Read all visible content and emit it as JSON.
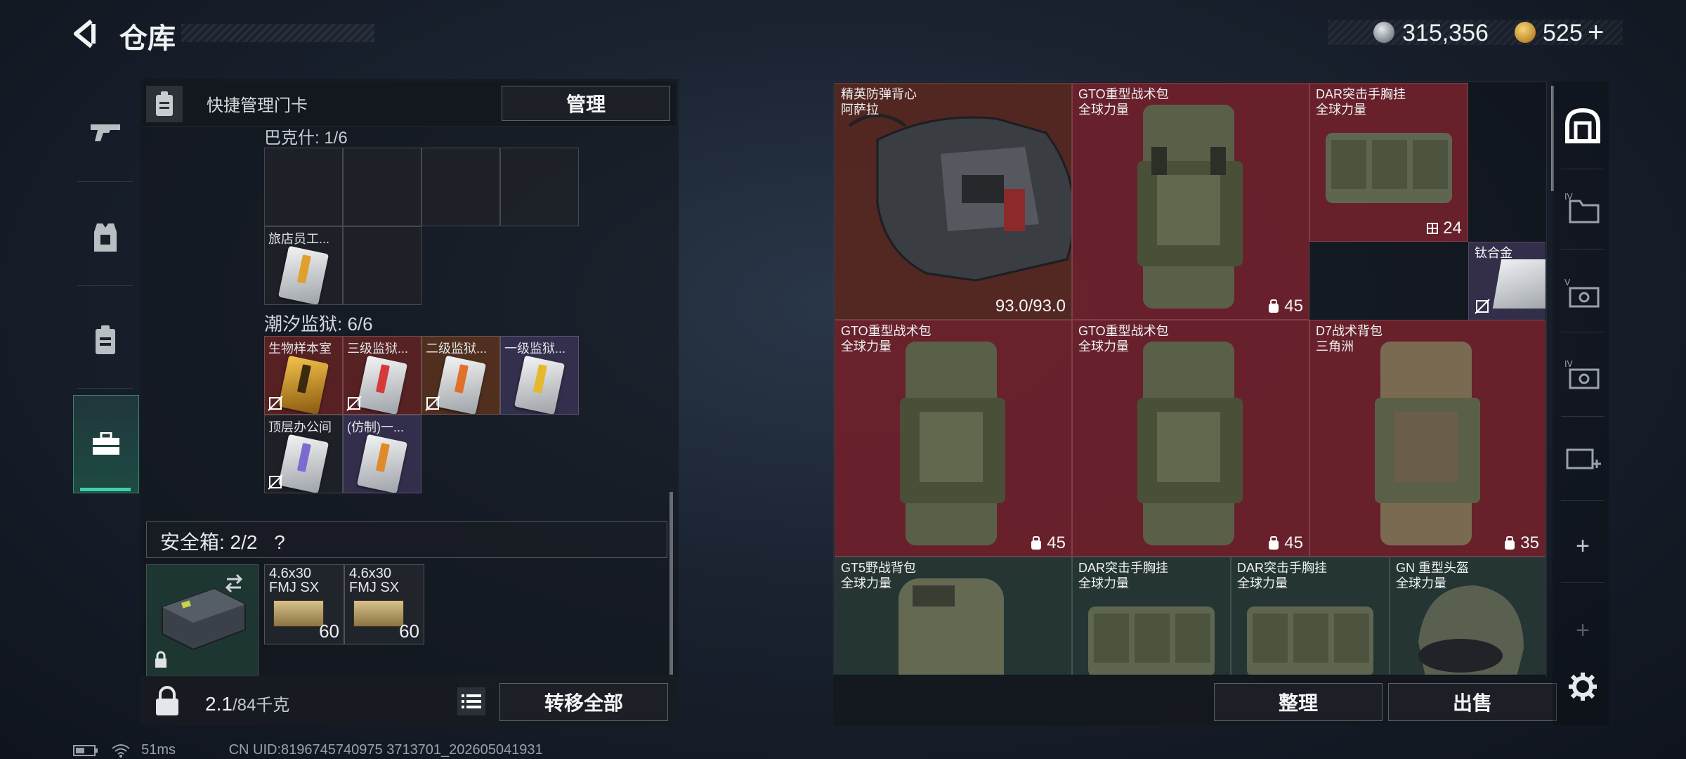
{
  "header": {
    "title": "仓库"
  },
  "currency": {
    "coins": "315,356",
    "premium": "525",
    "plus": "+"
  },
  "side_tabs": [
    "weapons",
    "armor",
    "keycard",
    "briefcase"
  ],
  "panel": {
    "header_label": "快捷管理门卡",
    "manage_btn": "管理",
    "clipped_section": "巴克什: 1/6",
    "section1_slots": [
      {
        "label": "旅店员工..."
      }
    ],
    "section2_title": "潮汐监狱: 6/6",
    "section2_slots": [
      {
        "label": "生物样本室"
      },
      {
        "label": "三级监狱..."
      },
      {
        "label": "二级监狱..."
      },
      {
        "label": "一级监狱..."
      },
      {
        "label": "顶层办公间"
      },
      {
        "label": "(仿制)一..."
      }
    ],
    "safe_box": {
      "label": "安全箱: 2/2",
      "help": "?"
    },
    "ammo": [
      {
        "label1": "4.6x30",
        "label2": "FMJ SX",
        "qty": "60"
      },
      {
        "label1": "4.6x30",
        "label2": "FMJ SX",
        "qty": "60"
      }
    ],
    "weight_value": "2.1",
    "weight_max": "/84千克",
    "transfer_btn": "转移全部"
  },
  "stash": {
    "items": [
      {
        "name": "精英防弹背心",
        "sub": "阿萨拉",
        "badge": "93.0/93.0",
        "color": "brown"
      },
      {
        "name": "GTO重型战术包",
        "sub": "全球力量",
        "badge": "45",
        "color": "red"
      },
      {
        "name": "DAR突击手胸挂",
        "sub": "全球力量",
        "badge": "24",
        "color": "red"
      },
      {
        "name": "钛合金",
        "sub": "",
        "badge": "",
        "color": "purple"
      },
      {
        "name": "GTO重型战术包",
        "sub": "全球力量",
        "badge": "45",
        "color": "red"
      },
      {
        "name": "GTO重型战术包",
        "sub": "全球力量",
        "badge": "45",
        "color": "red"
      },
      {
        "name": "D7战术背包",
        "sub": "三角洲",
        "badge": "35",
        "color": "red"
      },
      {
        "name": "GT5野战背包",
        "sub": "全球力量",
        "badge": "",
        "color": "green"
      },
      {
        "name": "DAR突击手胸挂",
        "sub": "全球力量",
        "badge": "",
        "color": "green"
      },
      {
        "name": "DAR突击手胸挂",
        "sub": "全球力量",
        "badge": "",
        "color": "green"
      },
      {
        "name": "GN 重型头盔",
        "sub": "全球力量",
        "badge": "",
        "color": "green"
      }
    ],
    "sort_btn": "整理",
    "sell_btn": "出售"
  },
  "status_bar": {
    "ping": "51ms",
    "uid": "CN UID:8196745740975 3713701_202605041931"
  }
}
